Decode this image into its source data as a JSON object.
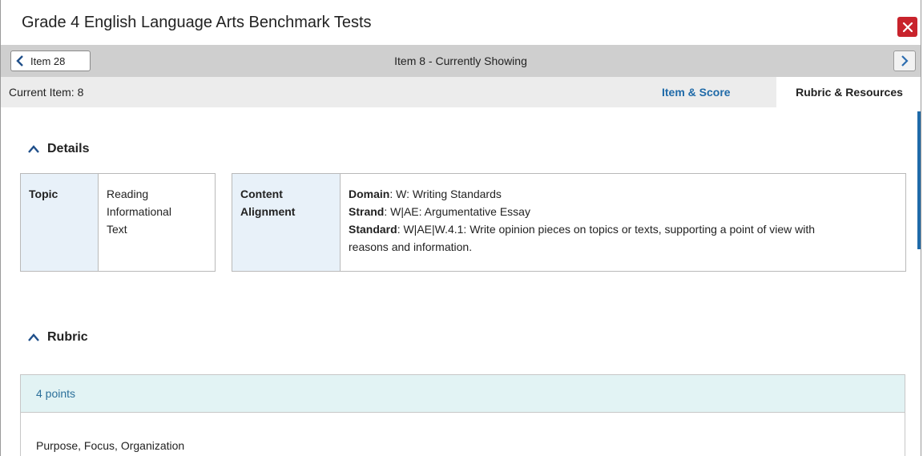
{
  "window": {
    "title": "Grade 4 English Language Arts Benchmark Tests"
  },
  "nav": {
    "prev_label": "Item 28",
    "current_label": "Item 8 - Currently Showing"
  },
  "tabs": {
    "current_item": "Current Item: 8",
    "score_tab": "Item & Score",
    "rubric_tab": "Rubric & Resources"
  },
  "details": {
    "heading": "Details",
    "topic_label": "Topic",
    "topic_value": [
      "Reading",
      "Informational",
      "Text"
    ],
    "alignment_label": [
      "Content",
      "Alignment"
    ],
    "domain_label": "Domain",
    "domain_value": ": W: Writing Standards",
    "strand_label": "Strand",
    "strand_value": ": W|AE: Argumentative Essay",
    "standard_label": "Standard",
    "standard_value_1": ": W|AE|W.4.1: Write opinion pieces on topics or texts, supporting a point of view with",
    "standard_value_2": "reasons and information."
  },
  "rubric": {
    "heading": "Rubric",
    "points": "4 points",
    "criterion": "Purpose, Focus, Organization"
  },
  "colors": {
    "accent": "#1f6aa8",
    "close": "#c8232c",
    "label_bg": "#e8f1f9",
    "rubric_bg": "#e2f3f4"
  },
  "icons": {
    "close": "close-icon",
    "prev": "chevron-left-icon",
    "next": "chevron-right-icon",
    "collapse": "chevron-up-icon"
  }
}
